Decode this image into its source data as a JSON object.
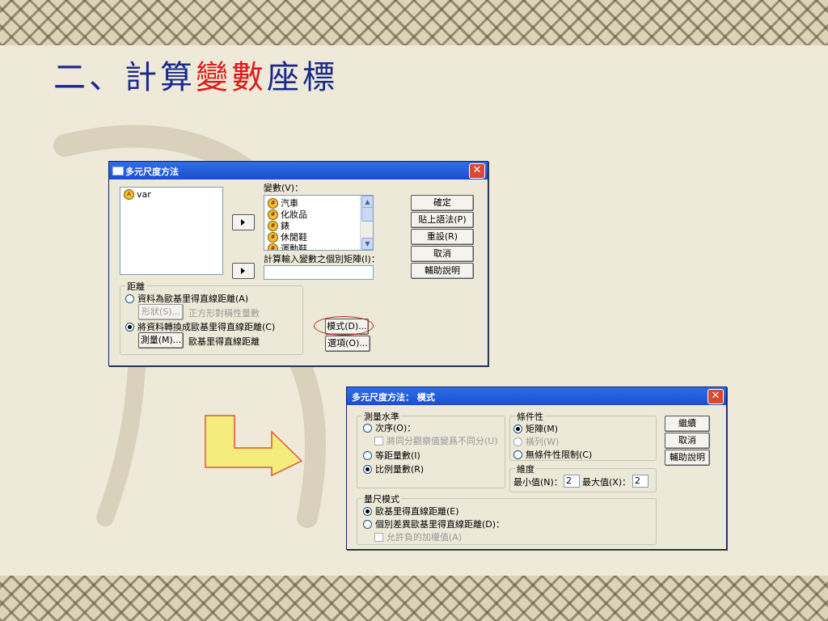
{
  "slide": {
    "title_blue_1": "二、計算",
    "title_red": "變數",
    "title_blue_2": "座標"
  },
  "dialog1": {
    "title": "多元尺度方法",
    "source_var": "var",
    "variables_label": "變數(V)：",
    "variables": [
      "汽車",
      "化妝品",
      "錶",
      "休閒鞋",
      "運動鞋"
    ],
    "matrix_label": "計算輸入變數之個別矩陣(I)：",
    "matrix_value": "",
    "buttons": {
      "ok": "確定",
      "paste": "貼上語法(P)",
      "reset": "重設(R)",
      "cancel": "取消",
      "help": "輔助說明"
    },
    "distance_group": "距離",
    "radio_data_is_distance": "資料為歐基里得直線距離(A)",
    "shape_button": "形狀(S)...",
    "shape_value": "正方形對稱性量數",
    "radio_create_distance": "將資料轉換成歐基里得直線距離(C)",
    "measure_button": "測量(M)...",
    "measure_value": "歐基里得直線距離",
    "model_button": "模式(D)...",
    "options_button": "選項(O)..."
  },
  "dialog2": {
    "title": "多元尺度方法： 模式",
    "measurement_group": "測量水準",
    "radio_ordinal": "次序(O)：",
    "check_untie": "將同分觀察值變爲不同分(U)",
    "radio_interval": "等距量數(I)",
    "radio_ratio": "比例量數(R)",
    "conditionality_group": "條件性",
    "radio_matrix": "矩陣(M)",
    "radio_row": "橫列(W)",
    "radio_unconditional": "無條件性限制(C)",
    "dimensions_group": "維度",
    "min_label": "最小值(N)：",
    "min_value": "2",
    "max_label": "最大值(X)：",
    "max_value": "2",
    "scaling_group": "量尺模式",
    "radio_euclidean": "歐基里得直線距離(E)",
    "radio_indiv": "個別差異歐基里得直線距離(D)：",
    "check_negative": "允許負的加權值(A)",
    "buttons": {
      "continue": "繼續",
      "cancel": "取消",
      "help": "輔助說明"
    }
  },
  "colors": {
    "title_blue": "#1a2a8c",
    "title_red": "#e01818",
    "titlebar": "#1a4fcf",
    "arrow": "#f4ec7c"
  }
}
